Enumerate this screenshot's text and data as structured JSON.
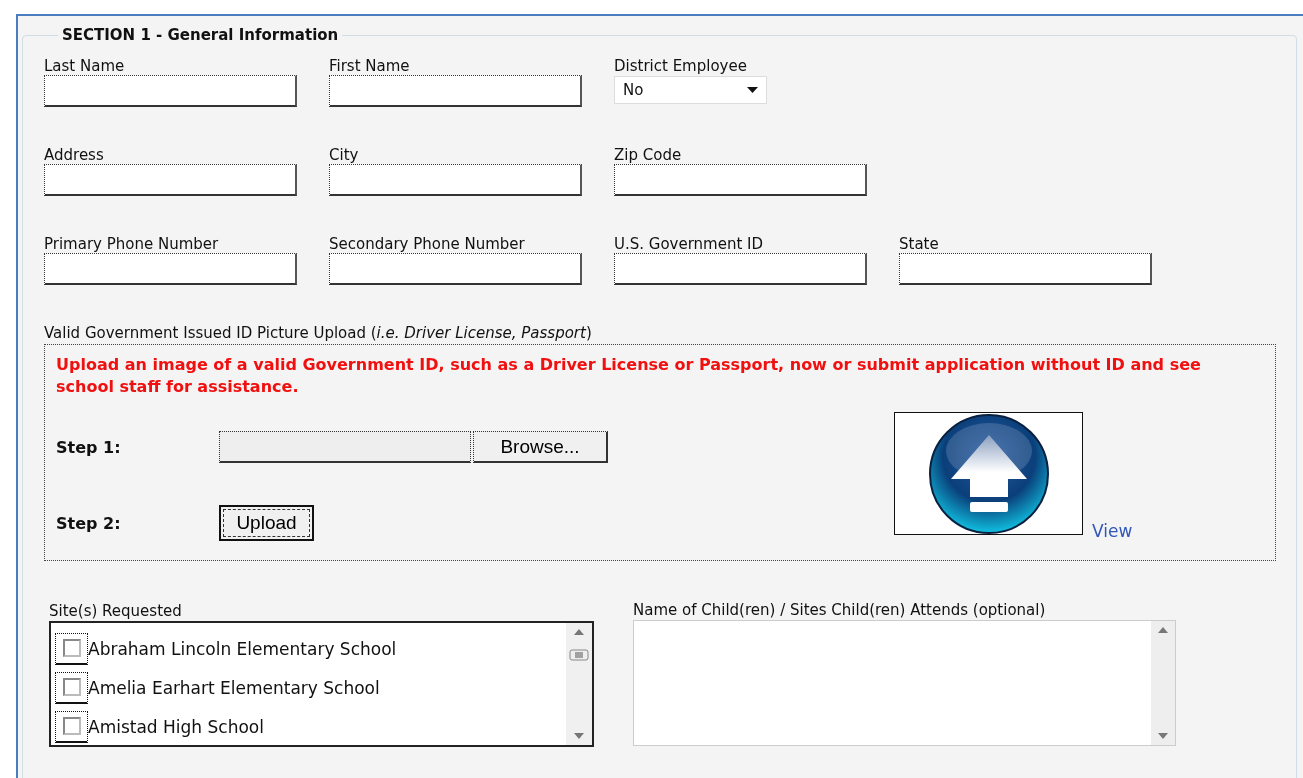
{
  "section": {
    "title": "SECTION 1 - General Information"
  },
  "field_rows": [
    [
      {
        "kind": "text",
        "label": "Last Name"
      },
      {
        "kind": "text",
        "label": "First Name"
      },
      {
        "kind": "select",
        "label": "District Employee",
        "value": "No"
      }
    ],
    [
      {
        "kind": "text",
        "label": "Address"
      },
      {
        "kind": "text",
        "label": "City"
      },
      {
        "kind": "text",
        "label": "Zip Code"
      }
    ],
    [
      {
        "kind": "text",
        "label": "Primary Phone Number"
      },
      {
        "kind": "text",
        "label": "Secondary Phone Number"
      },
      {
        "kind": "text",
        "label": "U.S. Government ID"
      },
      {
        "kind": "text",
        "label": "State"
      }
    ]
  ],
  "upload": {
    "label": "Valid Government Issued ID Picture Upload (*i.e. Driver License, Passport*)",
    "notice": "Upload an image of a valid Government ID, such as a Driver License or Passport, now or submit application without ID and see school staff for assistance.",
    "step_1": "Step 1:",
    "browse_button": "Browse...",
    "step_2": "Step 2:",
    "upload_button": "Upload",
    "view_link": "View"
  },
  "sites": {
    "label": "Site(s) Requested",
    "items": [
      {
        "label": "Abraham Lincoln Elementary School",
        "checked": false
      },
      {
        "label": "Amelia Earhart Elementary School",
        "checked": false
      },
      {
        "label": "Amistad High School",
        "checked": false
      }
    ]
  },
  "children": {
    "label": "Name of Child(ren) / Sites Child(ren) Attends (optional)"
  }
}
